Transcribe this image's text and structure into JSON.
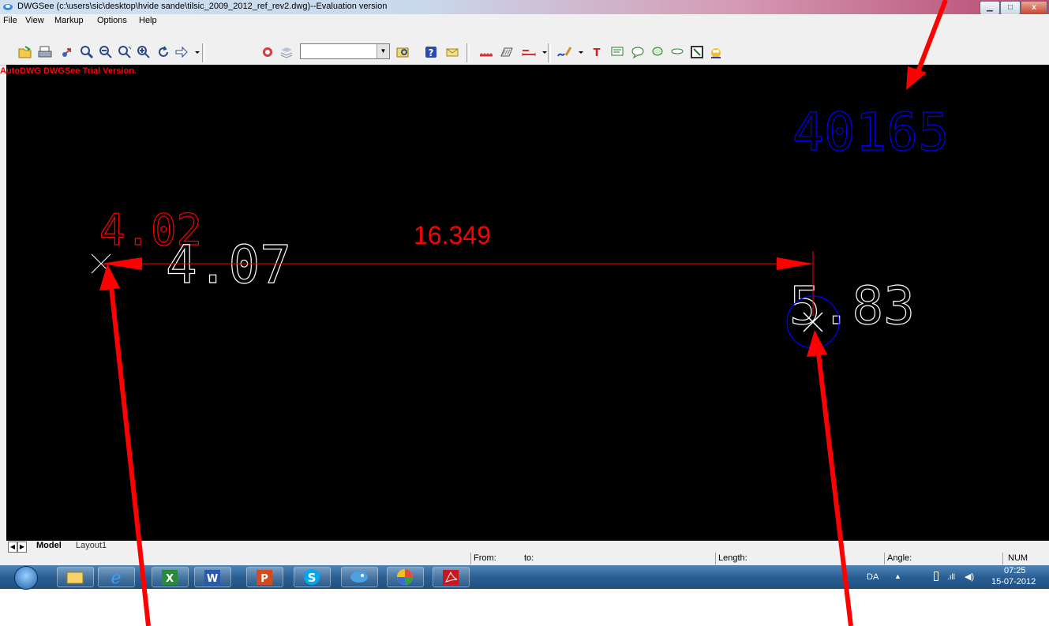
{
  "window": {
    "title": "DWGSee (c:\\users\\sic\\desktop\\hvide sande\\tilsic_2009_2012_ref_rev2.dwg)--Evaluation version",
    "controls": {
      "minimize": "▁",
      "maximize": "□",
      "close": "x"
    }
  },
  "menu": [
    "File",
    "View",
    "Markup",
    "Options",
    "Help"
  ],
  "toolbar": {
    "layer_combo_value": "",
    "icons": [
      "open-folder-icon",
      "print-icon",
      "pan-icon",
      "zoom-icon",
      "zoom-out-icon",
      "zoom-previous-icon",
      "zoom-window-icon",
      "rotate-icon",
      "next-arrow-icon",
      "layer-icon",
      "layers-icon",
      "browse-icon",
      "help-icon",
      "email-icon",
      "measure-distance-icon",
      "measure-area-icon",
      "dimension-icon",
      "pen-markup-icon",
      "text-markup-icon",
      "note-icon",
      "comment-icon",
      "cloud-icon",
      "callout-icon",
      "sketch-icon",
      "owl-icon"
    ]
  },
  "canvas": {
    "trial_banner": "AutoDWG DWGSee Trial Version.",
    "labels": {
      "top_right": "40165",
      "left_red": "4.02",
      "left_white": "4.07",
      "dimension": "16.349",
      "right_white": "5.83"
    },
    "colors": {
      "background": "#000000",
      "red": "#ff0000",
      "blue": "#0000ff",
      "white": "#ffffff"
    }
  },
  "layout_tabs": [
    "Model",
    "Layout1"
  ],
  "status": {
    "from_label": "From:",
    "to_label": "to:",
    "length_label": "Length:",
    "angle_label": "Angle:",
    "num": "NUM"
  },
  "taskbar": {
    "apps": [
      "start-orb",
      "explorer",
      "internet-explorer",
      "excel",
      "word",
      "powerpoint",
      "skype",
      "fish-app",
      "picasa",
      "acrobat"
    ],
    "tray": {
      "lang": "DA",
      "time": "07:25",
      "date": "15-07-2012"
    }
  }
}
